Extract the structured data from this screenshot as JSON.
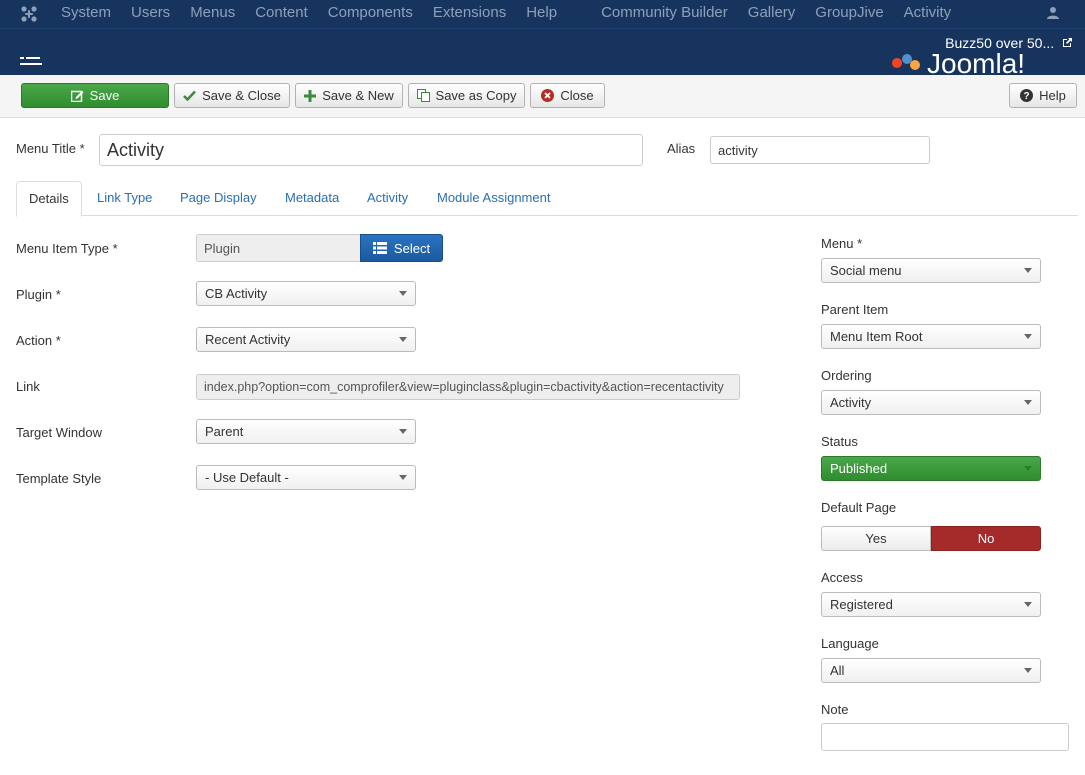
{
  "topbar": {
    "menu": [
      "System",
      "Users",
      "Menus",
      "Content",
      "Components",
      "Extensions",
      "Help",
      "Community Builder",
      "Gallery",
      "GroupJive",
      "Activity"
    ]
  },
  "header": {
    "site_name": "Buzz50 over 50..."
  },
  "toolbar": {
    "save": "Save",
    "save_close": "Save & Close",
    "save_new": "Save & New",
    "save_copy": "Save as Copy",
    "close": "Close",
    "help": "Help"
  },
  "form": {
    "menu_title_label": "Menu Title *",
    "menu_title_value": "Activity",
    "alias_label": "Alias",
    "alias_value": "activity"
  },
  "tabs": [
    "Details",
    "Link Type",
    "Page Display",
    "Metadata",
    "Activity",
    "Module Assignment"
  ],
  "details": {
    "menu_item_type_label": "Menu Item Type *",
    "menu_item_type_value": "Plugin",
    "select_label": "Select",
    "plugin_label": "Plugin *",
    "plugin_value": "CB Activity",
    "action_label": "Action *",
    "action_value": "Recent Activity",
    "link_label": "Link",
    "link_value": "index.php?option=com_comprofiler&view=pluginclass&plugin=cbactivity&action=recentactivity",
    "target_label": "Target Window",
    "target_value": "Parent",
    "template_label": "Template Style",
    "template_value": "- Use Default -"
  },
  "sidebar": {
    "menu_label": "Menu *",
    "menu_value": "Social menu",
    "parent_label": "Parent Item",
    "parent_value": "Menu Item Root",
    "ordering_label": "Ordering",
    "ordering_value": "Activity",
    "status_label": "Status",
    "status_value": "Published",
    "default_label": "Default Page",
    "default_yes": "Yes",
    "default_no": "No",
    "access_label": "Access",
    "access_value": "Registered",
    "language_label": "Language",
    "language_value": "All",
    "note_label": "Note",
    "note_value": ""
  },
  "colors": {
    "navbar": "#17345e",
    "save_green": "#3a9a3a",
    "select_blue": "#1f65ae",
    "no_red": "#a52a2a",
    "link_blue": "#2a6fb5"
  },
  "icons": [
    "joomla-logo-icon",
    "user-icon",
    "external-link-icon",
    "edit-icon",
    "check-icon",
    "plus-icon",
    "copy-icon",
    "close-circle-icon",
    "help-icon",
    "list-icon"
  ]
}
